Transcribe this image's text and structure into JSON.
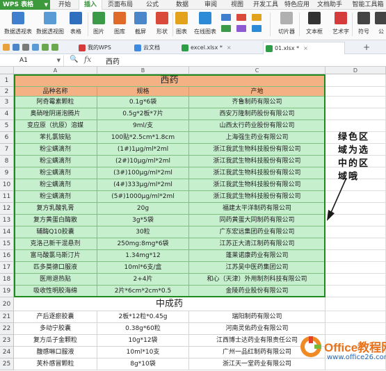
{
  "menubar": {
    "app_name": "WPS 表格",
    "tabs": [
      "开始",
      "插入",
      "页面布局",
      "公式",
      "数据",
      "审阅",
      "视图",
      "开发工具",
      "特色应用",
      "文档助手",
      "智能工具箱"
    ],
    "active_tab": "插入"
  },
  "ribbon": {
    "buttons": [
      {
        "label": "数据透视表",
        "icon": "pivot-table-icon",
        "color": "#3f7fce"
      },
      {
        "label": "数据透视图",
        "icon": "pivot-chart-icon",
        "color": "#5b9bd5"
      },
      {
        "label": "表格",
        "icon": "table-icon",
        "color": "#2f6fbd"
      },
      {
        "label": "图片",
        "icon": "picture-icon",
        "color": "#3a9a47"
      },
      {
        "label": "图库",
        "icon": "gallery-icon",
        "color": "#e06a2a"
      },
      {
        "label": "截屏",
        "icon": "screenshot-icon",
        "color": "#4a86c8"
      },
      {
        "label": "形状",
        "icon": "shape-icon",
        "color": "#d94a3b"
      },
      {
        "label": "图表",
        "icon": "chart-icon",
        "color": "#e2a21b"
      },
      {
        "label": "在线图表",
        "icon": "online-chart-icon",
        "color": "#2d8ad6"
      },
      {
        "label": "切片器",
        "icon": "slicer-icon",
        "color": "#b0b0b0"
      },
      {
        "label": "文本框",
        "icon": "textbox-icon",
        "color": "#333333"
      },
      {
        "label": "艺术字",
        "icon": "wordart-icon",
        "color": "#d63b3b"
      },
      {
        "label": "符号",
        "icon": "symbol-icon",
        "color": "#444444"
      },
      {
        "label": "公",
        "icon": "formula-icon",
        "color": "#444444"
      }
    ]
  },
  "docbar": {
    "tabs": [
      {
        "label": "我的WPS",
        "icon": "wps-logo-icon",
        "color": "#d63b3b"
      },
      {
        "label": "云文档",
        "icon": "cloud-doc-icon",
        "color": "#3c8be0"
      },
      {
        "label": "excel.xlsx *",
        "icon": "sheet-file-icon",
        "color": "#2e9d48"
      },
      {
        "label": "01.xlsx *",
        "icon": "sheet-file-icon",
        "color": "#2e9d48"
      }
    ],
    "active_tab_index": 3,
    "new_tab": "+"
  },
  "formula_bar": {
    "cell_ref": "A1",
    "fx": "fx",
    "value": "西药"
  },
  "columns": [
    "A",
    "B",
    "C",
    "D"
  ],
  "sheet": {
    "section1_title": "西药",
    "headers": [
      "品种名称",
      "规格",
      "产地"
    ],
    "rows": [
      [
        "阿奇霉素颗粒",
        "0.1g*6袋",
        "齐鲁制药有限公司"
      ],
      [
        "奥硝唑阴道泡腾片",
        "0.5g*2板*7片",
        "西安万隆制药股份有限公司"
      ],
      [
        "变应原（抗原）溶媒",
        "9ml/支",
        "山西太行药业股份有限公司"
      ],
      [
        "苯扎氯铵贴",
        "100贴*2.5cm*1.8cm",
        "上海强生药业有限公司"
      ],
      [
        "粉尘螨滴剂",
        "(1#)1μg/ml*2ml",
        "浙江我武生物科技股份有限公司"
      ],
      [
        "粉尘螨滴剂",
        "(2#)10μg/ml*2ml",
        "浙江我武生物科技股份有限公司"
      ],
      [
        "粉尘螨滴剂",
        "(3#)100μg/ml*2ml",
        "浙江我武生物科技股份有限公司"
      ],
      [
        "粉尘螨滴剂",
        "(4#)333μg/ml*2ml",
        "浙江我武生物科技股份有限公司"
      ],
      [
        "粉尘螨滴剂",
        "(5#)1000μg/ml*2ml",
        "浙江我武生物科技股份有限公司"
      ],
      [
        "复方乳酸乳膏",
        "20g",
        "福建太平洋制药有限公司"
      ],
      [
        "复方黄蛋白酶散",
        "3g*5袋",
        "同药黄蛋大同制药有限公司"
      ],
      [
        "辅酶Q10胶囊",
        "30粒",
        "广东宏远集团药业有限公司"
      ],
      [
        "克洛己新干混悬剂",
        "250mg:8mg*6袋",
        "江苏正大清江制药有限公司"
      ],
      [
        "富马酸氯马斯汀片",
        "1.34mg*12",
        "蓬莱诺康药业有限公司"
      ],
      [
        "匹多莫德口服液",
        "10ml*6支/盒",
        "江苏吴中医药集团公司"
      ],
      [
        "医用退热贴",
        "2+4片",
        "和心（天津）外用制剂科技有限公司"
      ],
      [
        "吸收性明胶海绵",
        "2片*6cm*2cm*0.5",
        "金陵药业股份有限公司"
      ]
    ],
    "section2_title": "中成药",
    "rows2": [
      [
        "产后逐瘀胶囊",
        "2板*12粒*0.45g",
        "瑞阳制药有限公司"
      ],
      [
        "多动宁胶囊",
        "0.38g*60粒",
        "河南灵佑药业有限公司"
      ],
      [
        "复方瓜子金颗粒",
        "10g*12袋",
        "江西博士达药业有限责任公司"
      ],
      [
        "馥感啉口服液",
        "10ml*10支",
        "广州一品红制药有限公司"
      ],
      [
        "芙朴感冒颗粒",
        "8g*10袋",
        "浙江天一堂药业有限公司"
      ]
    ],
    "row_numbers": [
      "1",
      "2",
      "3",
      "4",
      "5",
      "6",
      "7",
      "8",
      "9",
      "10",
      "11",
      "12",
      "13",
      "14",
      "15",
      "16",
      "17",
      "18",
      "19",
      "20",
      "21",
      "22",
      "23",
      "24",
      "25"
    ]
  },
  "annotation": {
    "lines": [
      "绿色区",
      "域为选",
      "中的区",
      "域哦"
    ]
  },
  "watermark": {
    "name": "Office教程网",
    "url": "www.office26.com"
  },
  "colors": {
    "selection_fill": "#c6efce",
    "selection_border": "#1e8b1e",
    "header_fill": "#f4b183",
    "accent": "#3c9a3c"
  }
}
